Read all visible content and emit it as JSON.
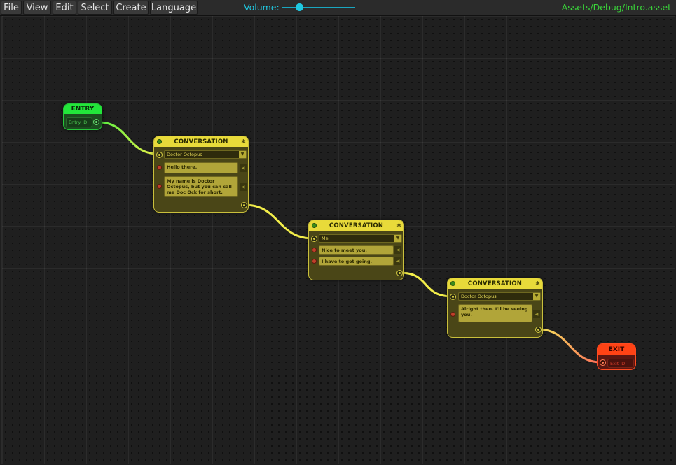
{
  "menu": {
    "file": "File",
    "view": "View",
    "edit": "Edit",
    "select": "Select",
    "create": "Create",
    "language": "Language"
  },
  "volume": {
    "label": "Volume:",
    "level": 0.24
  },
  "asset_path": "Assets/Debug/Intro.asset",
  "colors": {
    "entry": "#22e63a",
    "exit": "#ff4315",
    "conversation": "#e8da3a",
    "volume": "#20c8e0",
    "path": "#3ad63a"
  },
  "entry_node": {
    "title": "ENTRY",
    "field": "Entry ID"
  },
  "exit_node": {
    "title": "EXIT",
    "field": "Exit ID"
  },
  "conversations": [
    {
      "title": "CONVERSATION",
      "speaker": "Doctor Octopus",
      "lines": [
        "Hello there.",
        "My name is Doctor Octopus, but you can call me Doc Ock for short."
      ]
    },
    {
      "title": "CONVERSATION",
      "speaker": "Me",
      "lines": [
        "Nice to meet you.",
        "I have to got going."
      ]
    },
    {
      "title": "CONVERSATION",
      "speaker": "Doctor Octopus",
      "lines": [
        "Alright then. I'll be seeing you."
      ]
    }
  ]
}
